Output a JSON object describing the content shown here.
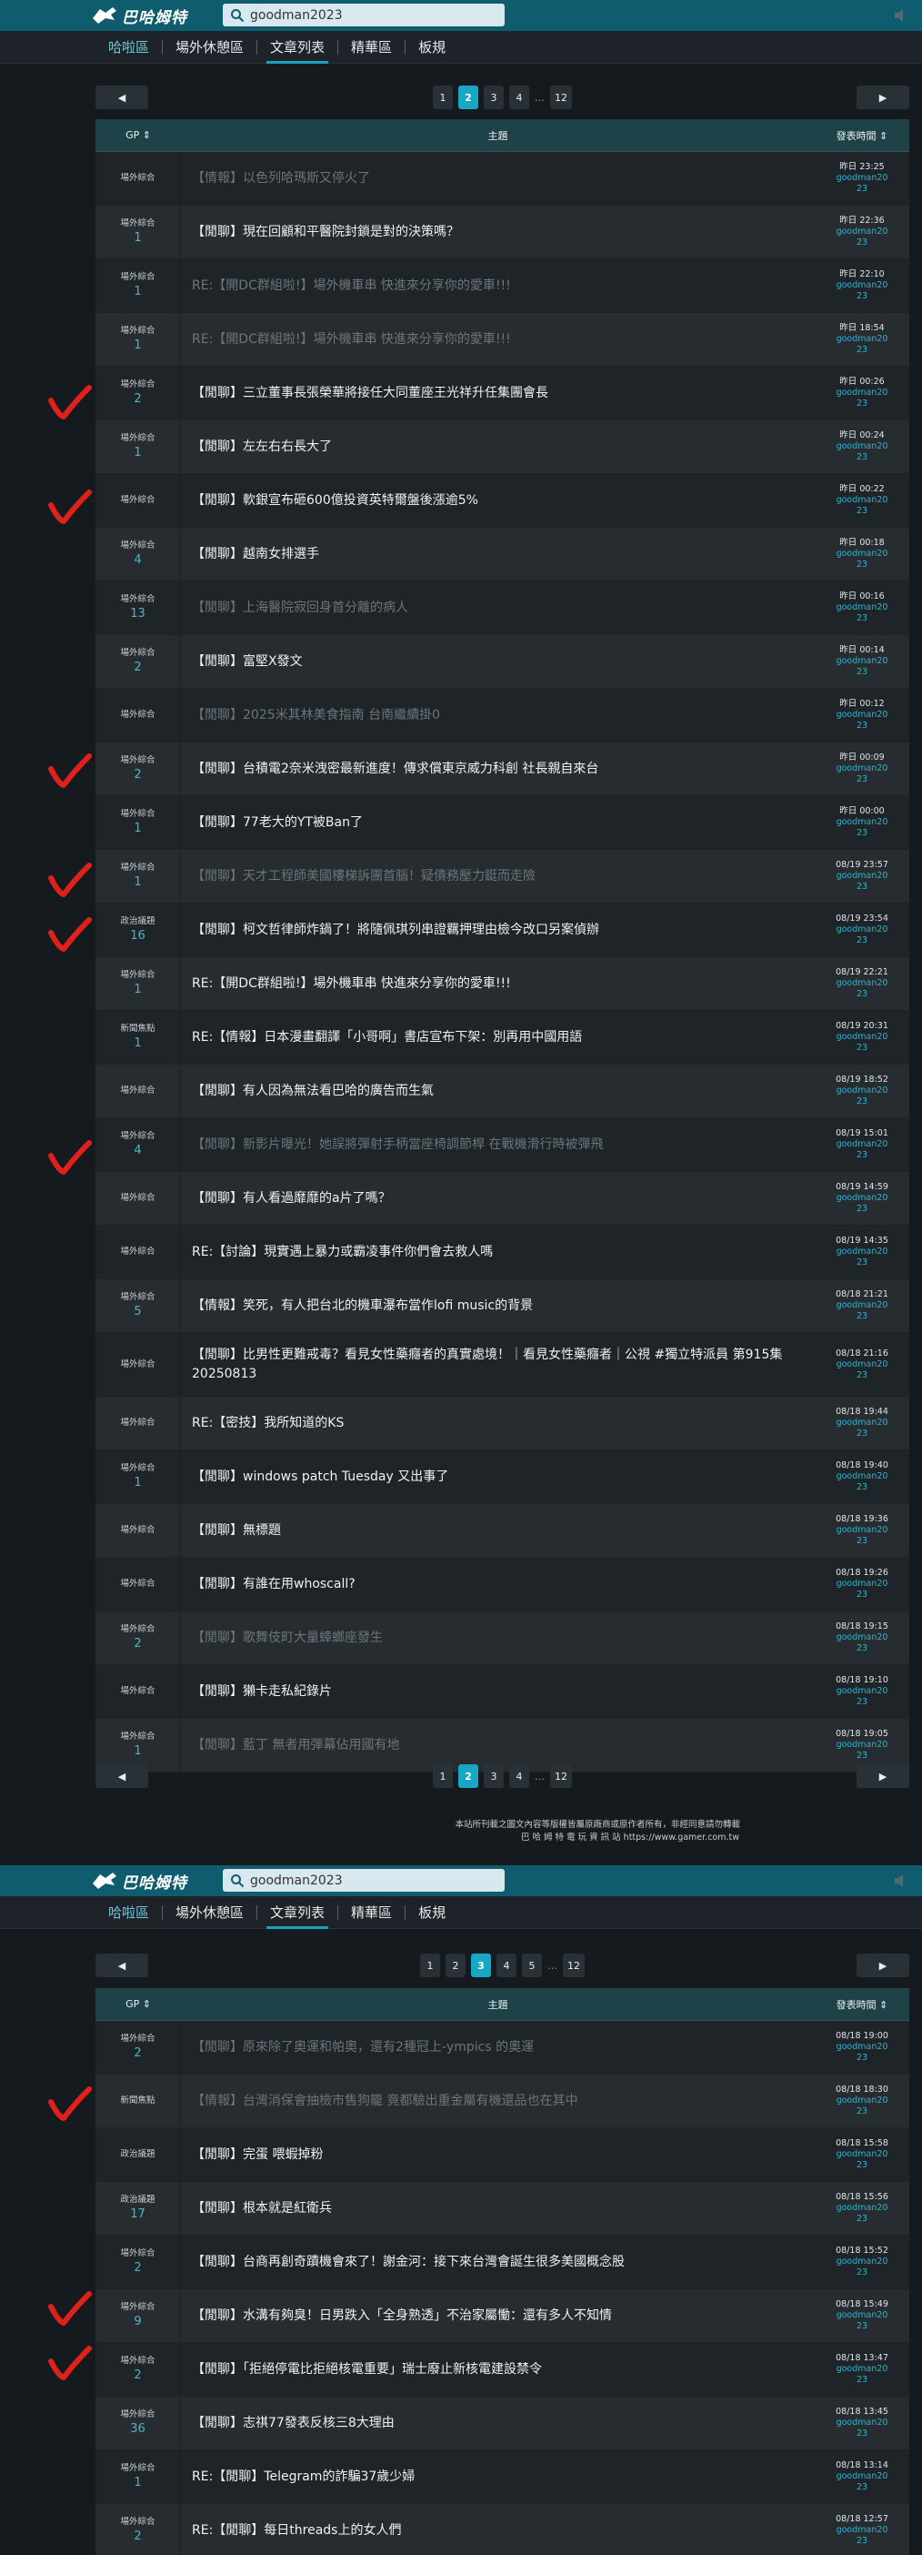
{
  "header": {
    "logo_text": "巴哈姆特",
    "search_value": "goodman2023",
    "brand_color": "#0f5c6e",
    "accent_color": "#17a6c4"
  },
  "nav": {
    "tabs": [
      "哈啦區",
      "場外休憩區",
      "文章列表",
      "精華區",
      "板規"
    ],
    "active_tab": "文章列表"
  },
  "table_headers": {
    "gp": "GP ⇕",
    "title": "主題",
    "time": "發表時間 ⇕"
  },
  "page1": {
    "pager": {
      "prev": "◀",
      "next": "▶",
      "pages": [
        "1",
        "2",
        "3",
        "4",
        "…",
        "12"
      ],
      "current": "2"
    },
    "rows": [
      {
        "cat": "場外綜合",
        "gp": "",
        "title": "【情報】以色列哈瑪斯又停火了",
        "read": true,
        "time": "昨日 23:25",
        "user": "goodman2023"
      },
      {
        "cat": "場外綜合",
        "gp": "1",
        "title": "【閒聊】現在回顧和平醫院封鎖是對的決策嗎？",
        "read": false,
        "time": "昨日 22:36",
        "user": "goodman2023"
      },
      {
        "cat": "場外綜合",
        "gp": "1",
        "title": "RE:【開DC群組啦!】場外機車串 快進來分享你的愛車!!!",
        "read": true,
        "time": "昨日 22:10",
        "user": "goodman2023"
      },
      {
        "cat": "場外綜合",
        "gp": "1",
        "title": "RE:【開DC群組啦!】場外機車串 快進來分享你的愛車!!!",
        "read": true,
        "time": "昨日 18:54",
        "user": "goodman2023"
      },
      {
        "cat": "場外綜合",
        "gp": "2",
        "title": "【閒聊】三立董事長張榮華將接任大同董座王光祥升任集團會長",
        "read": false,
        "time": "昨日 00:26",
        "user": "goodman2023"
      },
      {
        "cat": "場外綜合",
        "gp": "1",
        "title": "【閒聊】左左右右長大了",
        "read": false,
        "time": "昨日 00:24",
        "user": "goodman2023"
      },
      {
        "cat": "場外綜合",
        "gp": "",
        "title": "【閒聊】軟銀宣布砸600億投資英特爾盤後漲逾5%",
        "read": false,
        "time": "昨日 00:22",
        "user": "goodman2023"
      },
      {
        "cat": "場外綜合",
        "gp": "4",
        "title": "【閒聊】越南女排選手",
        "read": false,
        "time": "昨日 00:18",
        "user": "goodman2023"
      },
      {
        "cat": "場外綜合",
        "gp": "13",
        "title": "【閒聊】上海醫院寂回身首分離的病人",
        "read": true,
        "time": "昨日 00:16",
        "user": "goodman2023"
      },
      {
        "cat": "場外綜合",
        "gp": "2",
        "title": "【閒聊】富堅X發文",
        "read": false,
        "time": "昨日 00:14",
        "user": "goodman2023"
      },
      {
        "cat": "場外綜合",
        "gp": "",
        "title": "【閒聊】2025米其林美食指南 台南繼續掛0",
        "read": true,
        "time": "昨日 00:12",
        "user": "goodman2023"
      },
      {
        "cat": "場外綜合",
        "gp": "2",
        "title": "【閒聊】台積電2奈米洩密最新進度！傳求償東京威力科創 社長親自來台",
        "read": false,
        "time": "昨日 00:09",
        "user": "goodman2023"
      },
      {
        "cat": "場外綜合",
        "gp": "1",
        "title": "【閒聊】77老大的YT被Ban了",
        "read": false,
        "time": "昨日 00:00",
        "user": "goodman2023"
      },
      {
        "cat": "場外綜合",
        "gp": "1",
        "title": "【閒聊】天才工程師美國樓梯訴團首腦！疑債務壓力鋌而走險",
        "read": true,
        "time": "08/19 23:57",
        "user": "goodman2023"
      },
      {
        "cat": "政治議題",
        "gp": "16",
        "title": "【閒聊】柯文哲律師炸鍋了！將隨佩琪列串證羈押理由檢今改口另案偵辦",
        "read": false,
        "time": "08/19 23:54",
        "user": "goodman2023"
      },
      {
        "cat": "場外綜合",
        "gp": "1",
        "title": "RE:【開DC群組啦!】場外機車串 快進來分享你的愛車!!!",
        "read": false,
        "time": "08/19 22:21",
        "user": "goodman2023"
      },
      {
        "cat": "新聞焦點",
        "gp": "1",
        "title": "RE:【情報】日本漫畫翻譯「小哥啊」書店宣布下架：別再用中國用語",
        "read": false,
        "time": "08/19 20:31",
        "user": "goodman2023"
      },
      {
        "cat": "場外綜合",
        "gp": "",
        "title": "【閒聊】有人因為無法看巴哈的廣告而生氣",
        "read": false,
        "time": "08/19 18:52",
        "user": "goodman2023"
      },
      {
        "cat": "場外綜合",
        "gp": "4",
        "title": "【閒聊】新影片曝光！她誤將彈射手柄當座椅調節桿 在戰機滑行時被彈飛",
        "read": true,
        "time": "08/19 15:01",
        "user": "goodman2023"
      },
      {
        "cat": "場外綜合",
        "gp": "",
        "title": "【閒聊】有人看過靡靡的a片了嗎？",
        "read": false,
        "time": "08/19 14:59",
        "user": "goodman2023"
      },
      {
        "cat": "場外綜合",
        "gp": "",
        "title": "RE:【討論】現實遇上暴力或霸凌事件你們會去救人嗎",
        "read": false,
        "time": "08/19 14:35",
        "user": "goodman2023"
      },
      {
        "cat": "場外綜合",
        "gp": "5",
        "title": "【情報】笑死，有人把台北的機車瀑布當作lofi music的背景",
        "read": false,
        "time": "08/18 21:21",
        "user": "goodman2023"
      },
      {
        "cat": "場外綜合",
        "gp": "",
        "title": "【閒聊】比男性更難戒毒？看見女性藥癮者的真實處境！｜看見女性藥癮者｜公視 #獨立特派員 第915集 20250813",
        "read": false,
        "time": "08/18 21:16",
        "user": "goodman2023"
      },
      {
        "cat": "場外綜合",
        "gp": "",
        "title": "RE:【密技】我所知道的KS",
        "read": false,
        "time": "08/18 19:44",
        "user": "goodman2023"
      },
      {
        "cat": "場外綜合",
        "gp": "1",
        "title": "【閒聊】windows patch Tuesday 又出事了",
        "read": false,
        "time": "08/18 19:40",
        "user": "goodman2023"
      },
      {
        "cat": "場外綜合",
        "gp": "",
        "title": "【閒聊】無標題",
        "read": false,
        "time": "08/18 19:36",
        "user": "goodman2023"
      },
      {
        "cat": "場外綜合",
        "gp": "",
        "title": "【閒聊】有誰在用whoscall?",
        "read": false,
        "time": "08/18 19:26",
        "user": "goodman2023"
      },
      {
        "cat": "場外綜合",
        "gp": "2",
        "title": "【閒聊】歌舞伎町大量蟑螂座發生",
        "read": true,
        "time": "08/18 19:15",
        "user": "goodman2023"
      },
      {
        "cat": "場外綜合",
        "gp": "",
        "title": "【閒聊】獺卡走私紀錄片",
        "read": false,
        "time": "08/18 19:10",
        "user": "goodman2023"
      },
      {
        "cat": "場外綜合",
        "gp": "1",
        "title": "【閒聊】藍丁 無者用彈幕佔用國有地",
        "read": true,
        "time": "08/18 19:05",
        "user": "goodman2023"
      }
    ]
  },
  "footer": {
    "line1": "本站所刊載之圖文內容等版權皆屬原廠商或原作者所有，非經同意請勿轉載",
    "line2": "巴 哈 姆 特 電 玩 資 訊 站 https://www.gamer.com.tw"
  },
  "page2": {
    "pager": {
      "prev": "◀",
      "next": "▶",
      "pages": [
        "1",
        "2",
        "3",
        "4",
        "5",
        "…",
        "12"
      ],
      "current": "3"
    },
    "rows": [
      {
        "cat": "場外綜合",
        "gp": "2",
        "title": "【閒聊】原來除了奧運和帕奧，還有2種冠上-ympics 的奧運",
        "read": true,
        "time": "08/18 19:00",
        "user": "goodman2023"
      },
      {
        "cat": "新聞焦點",
        "gp": "",
        "title": "【情報】台灣消保會抽檢市售狗籠 竟都驗出重金屬有機還品也在其中",
        "read": true,
        "time": "08/18 18:30",
        "user": "goodman2023"
      },
      {
        "cat": "政治議題",
        "gp": "",
        "title": "【閒聊】完蛋 喂蝦掉粉",
        "read": false,
        "time": "08/18 15:58",
        "user": "goodman2023"
      },
      {
        "cat": "政治議題",
        "gp": "17",
        "title": "【閒聊】根本就是紅衛兵",
        "read": false,
        "time": "08/18 15:56",
        "user": "goodman2023"
      },
      {
        "cat": "場外綜合",
        "gp": "2",
        "title": "【閒聊】台商再創奇蹟機會來了！謝金河：接下來台灣會誕生很多美國概念股",
        "read": false,
        "time": "08/18 15:52",
        "user": "goodman2023"
      },
      {
        "cat": "場外綜合",
        "gp": "9",
        "title": "【閒聊】水溝有夠臭！日男跌入「全身熟透」不治家屬慟：還有多人不知情",
        "read": false,
        "time": "08/18 15:49",
        "user": "goodman2023"
      },
      {
        "cat": "場外綜合",
        "gp": "2",
        "title": "【閒聊】「拒絕停電比拒絕核電重要」瑞士廢止新核電建設禁令",
        "read": false,
        "time": "08/18 13:47",
        "user": "goodman2023"
      },
      {
        "cat": "場外綜合",
        "gp": "36",
        "title": "【閒聊】志祺77發表反核三8大理由",
        "read": false,
        "time": "08/18 13:45",
        "user": "goodman2023"
      },
      {
        "cat": "場外綜合",
        "gp": "1",
        "title": "RE:【閒聊】Telegram的詐騙37歲少婦",
        "read": false,
        "time": "08/18 13:14",
        "user": "goodman2023"
      },
      {
        "cat": "場外綜合",
        "gp": "2",
        "title": "RE:【閒聊】每日threads上的女人們",
        "read": false,
        "time": "08/18 12:57",
        "user": "goodman2023"
      }
    ]
  },
  "annotation_color": "#e0201a"
}
